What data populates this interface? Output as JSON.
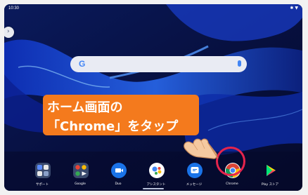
{
  "status_bar": {
    "time": "10:30",
    "icons": [
      "bluetooth-icon",
      "wifi-icon"
    ]
  },
  "search_bar": {
    "logo": "G",
    "icon": "mic-icon"
  },
  "callout": {
    "line1": "ホーム画面の",
    "line2": "「Chrome」をタップ",
    "color": "#f47a1d"
  },
  "dock": {
    "apps": [
      {
        "label": "サポート",
        "icon": "folder-support-icon"
      },
      {
        "label": "Google",
        "icon": "google-folder-icon"
      },
      {
        "label": "Duo",
        "icon": "duo-icon"
      },
      {
        "label": "アシスタント",
        "icon": "assistant-icon"
      },
      {
        "label": "メッセージ",
        "icon": "messages-icon"
      },
      {
        "label": "Chrome",
        "icon": "chrome-icon"
      },
      {
        "label": "Play ストア",
        "icon": "play-store-icon"
      }
    ],
    "highlight_color": "#e5244c"
  }
}
